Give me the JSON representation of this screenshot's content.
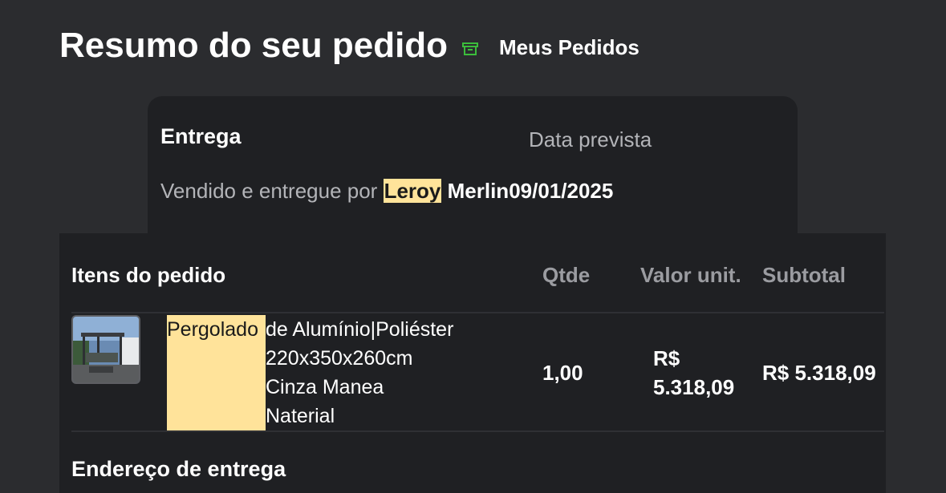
{
  "header": {
    "title": "Resumo do seu pedido",
    "archive_icon": "archive-box-icon",
    "my_orders_link": "Meus Pedidos"
  },
  "delivery": {
    "title": "Entrega",
    "date_label": "Data prevista",
    "sold_by_text": "Vendido e entregue por",
    "seller_highlight": "Leroy",
    "seller_rest": "Merlin",
    "date_value": "09/01/2025"
  },
  "items": {
    "header": {
      "items": "Itens do pedido",
      "qty": "Qtde",
      "unit_price": "Valor unit.",
      "subtotal": "Subtotal"
    },
    "rows": [
      {
        "name_highlight": "Pergolado",
        "name_lines": [
          "de Alumínio|Poliéster",
          "220x350x260cm",
          "Cinza Manea",
          "Naterial"
        ],
        "qty": "1,00",
        "unit_price_currency": "R$",
        "unit_price_value": "5.318,09",
        "subtotal": "R$ 5.318,09"
      }
    ]
  },
  "address": {
    "title": "Endereço de entrega"
  },
  "colors": {
    "background": "#2b2c2f",
    "card": "#1f2023",
    "highlight": "#ffe39a",
    "icon_green": "#3bbd3b",
    "muted_text": "#9b9ca1"
  }
}
